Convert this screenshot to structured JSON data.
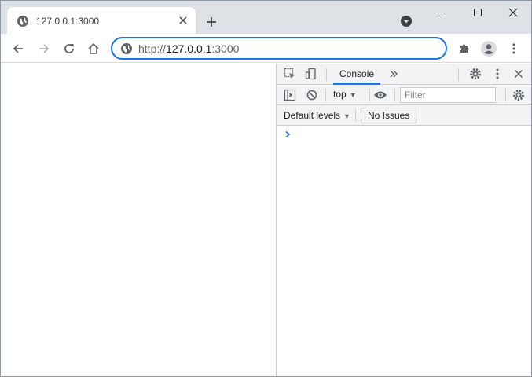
{
  "tab": {
    "title": "127.0.0.1:3000",
    "favicon": "globe-icon"
  },
  "omnibox": {
    "url_scheme": "http://",
    "url_host": "127.0.0.1",
    "url_port": ":3000",
    "site_icon": "globe-icon"
  },
  "devtools": {
    "active_tab": "Console",
    "context": "top",
    "filter_placeholder": "Filter",
    "levels_label": "Default levels",
    "issues_label": "No Issues"
  },
  "colors": {
    "accent": "#1a73e8",
    "tabstrip": "#dee1e6",
    "devtools_toolbar": "#f1f3f4"
  }
}
